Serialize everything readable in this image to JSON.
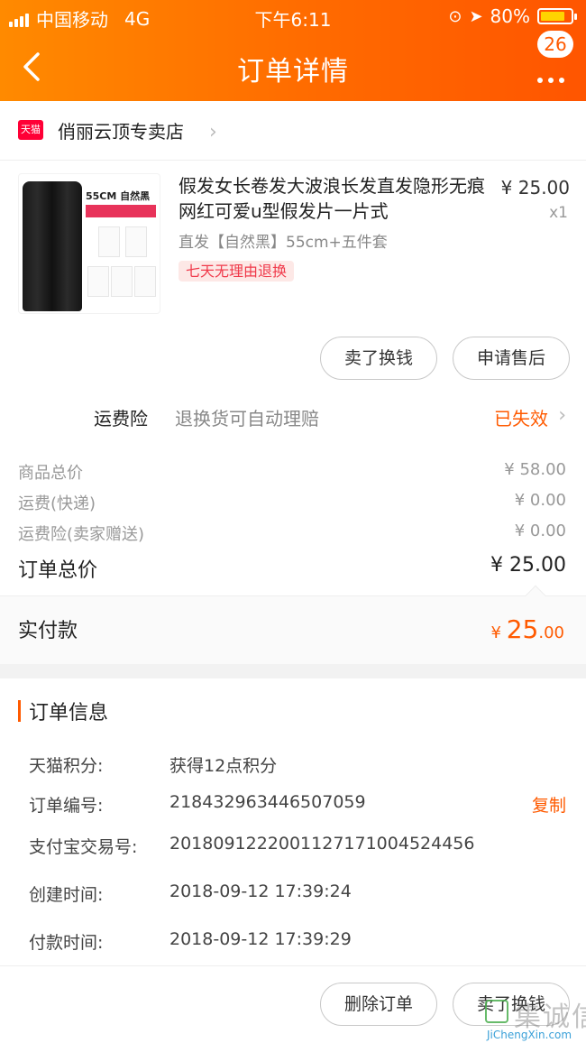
{
  "status_bar": {
    "carrier": "中国移动",
    "network": "4G",
    "time": "下午6:11",
    "battery": "80%",
    "battery_level": 0.8
  },
  "header": {
    "title": "订单详情",
    "badge": "26",
    "bg_colors": [
      "#ff8a00",
      "#ff5500"
    ]
  },
  "store": {
    "logo_text": "天猫",
    "name": "俏丽云顶专卖店"
  },
  "product": {
    "image_size_text": "55CM 自然黑",
    "name": "假发女长卷发大波浪长发直发隐形无痕网红可爱u型假发片一片式",
    "price": "¥ 25.00",
    "quantity": "x1",
    "sku": "直发【自然黑】55cm+五件套",
    "return_tag": "七天无理由退换"
  },
  "item_actions": {
    "sell": "卖了换钱",
    "after_sale": "申请售后"
  },
  "shipping_insurance": {
    "label": "运费险",
    "desc": "退换货可自动理赔",
    "status": "已失效"
  },
  "cost_rows": [
    {
      "label": "商品总价",
      "value": "¥ 58.00"
    },
    {
      "label": "运费(快递)",
      "value": "¥ 0.00"
    },
    {
      "label": "运费险(卖家赠送)",
      "value": "¥ 0.00"
    }
  ],
  "order_total": {
    "label": "订单总价",
    "value": "¥ 25.00"
  },
  "paid": {
    "label": "实付款",
    "currency": "¥",
    "int": "25",
    "dec": ".00"
  },
  "order_info": {
    "title": "订单信息",
    "rows": [
      {
        "label": "天猫积分:",
        "value": "获得12点积分"
      },
      {
        "label": "订单编号:",
        "value": "218432963446507059",
        "action": "复制"
      },
      {
        "label": "支付宝交易号:",
        "value": "2018091222001127171004524456"
      },
      {
        "label": "创建时间:",
        "value": "2018-09-12 17:39:24"
      },
      {
        "label": "付款时间:",
        "value": "2018-09-12 17:39:29"
      }
    ]
  },
  "footer_actions": {
    "delete": "删除订单",
    "sell": "卖了换钱"
  },
  "watermark": {
    "cn": "集诚信",
    "en": "JiChengXin.com"
  },
  "colors": {
    "accent": "#ff5a00",
    "tag_red": "#f0394a"
  }
}
